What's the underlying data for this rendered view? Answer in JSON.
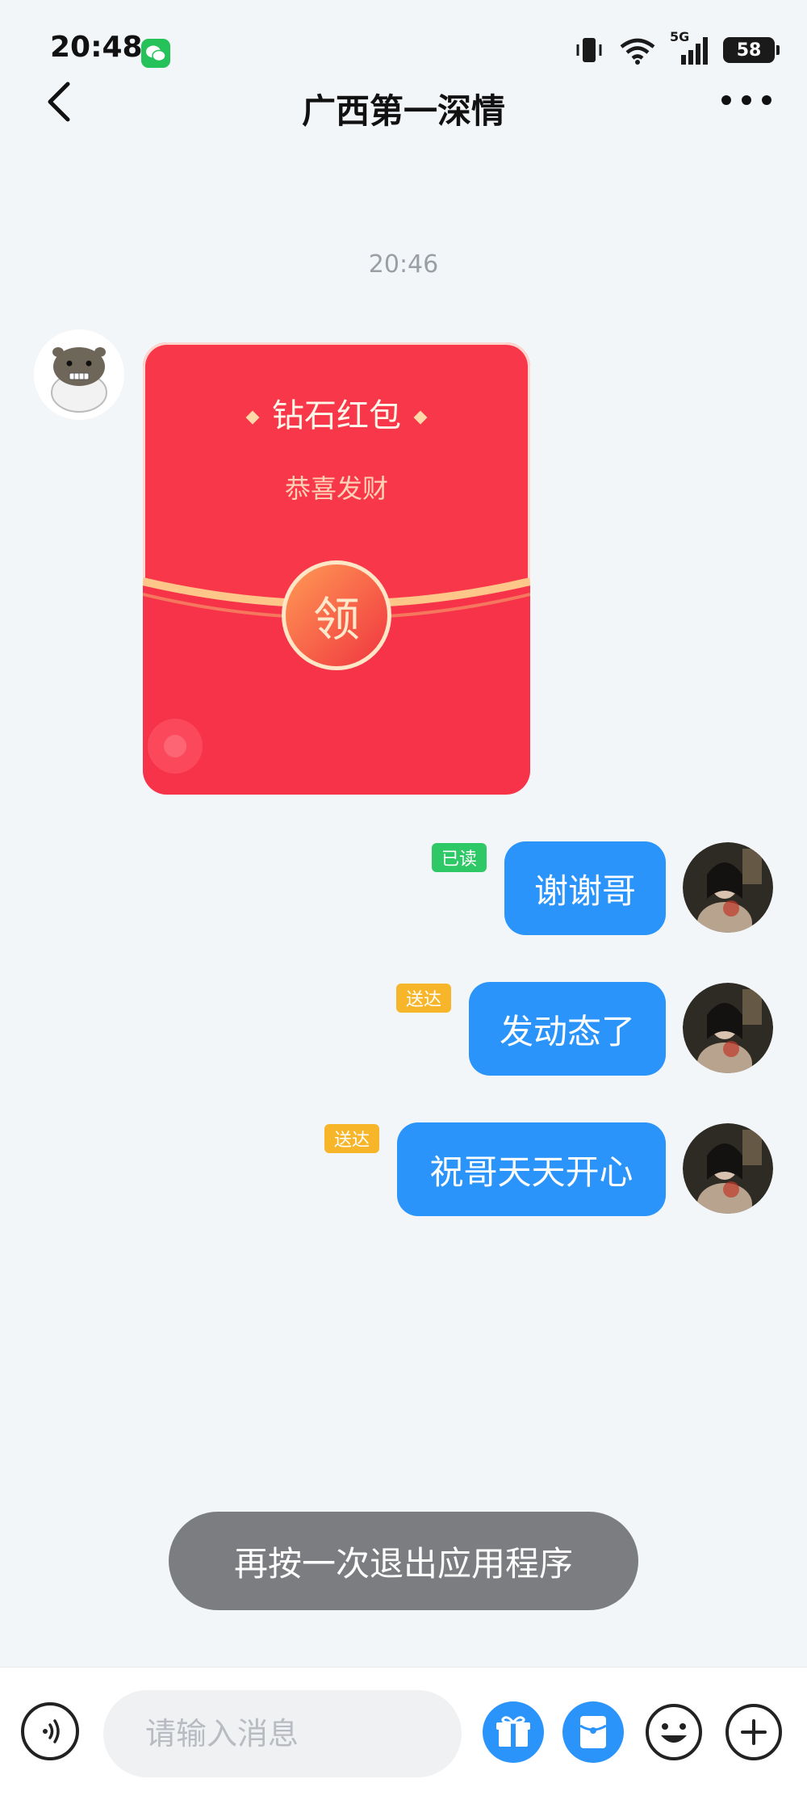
{
  "status_bar": {
    "time": "20:48",
    "network": "5G",
    "battery": "58"
  },
  "nav": {
    "title": "广西第一深情"
  },
  "chat": {
    "timestamp": "20:46",
    "red_packet": {
      "title": "钻石红包",
      "subtitle": "恭喜发财",
      "claim_label": "领"
    },
    "messages": [
      {
        "text": "谢谢哥",
        "status": "已读"
      },
      {
        "text": "发动态了",
        "status": "送达"
      },
      {
        "text": "祝哥天天开心",
        "status": "送达"
      }
    ]
  },
  "toast": "再按一次退出应用程序",
  "input": {
    "placeholder": "请输入消息"
  },
  "colors": {
    "bubble_blue": "#2a94fb",
    "red_packet": "#f8384a",
    "read_tag": "#2fc866",
    "sent_tag": "#f7b52a"
  }
}
